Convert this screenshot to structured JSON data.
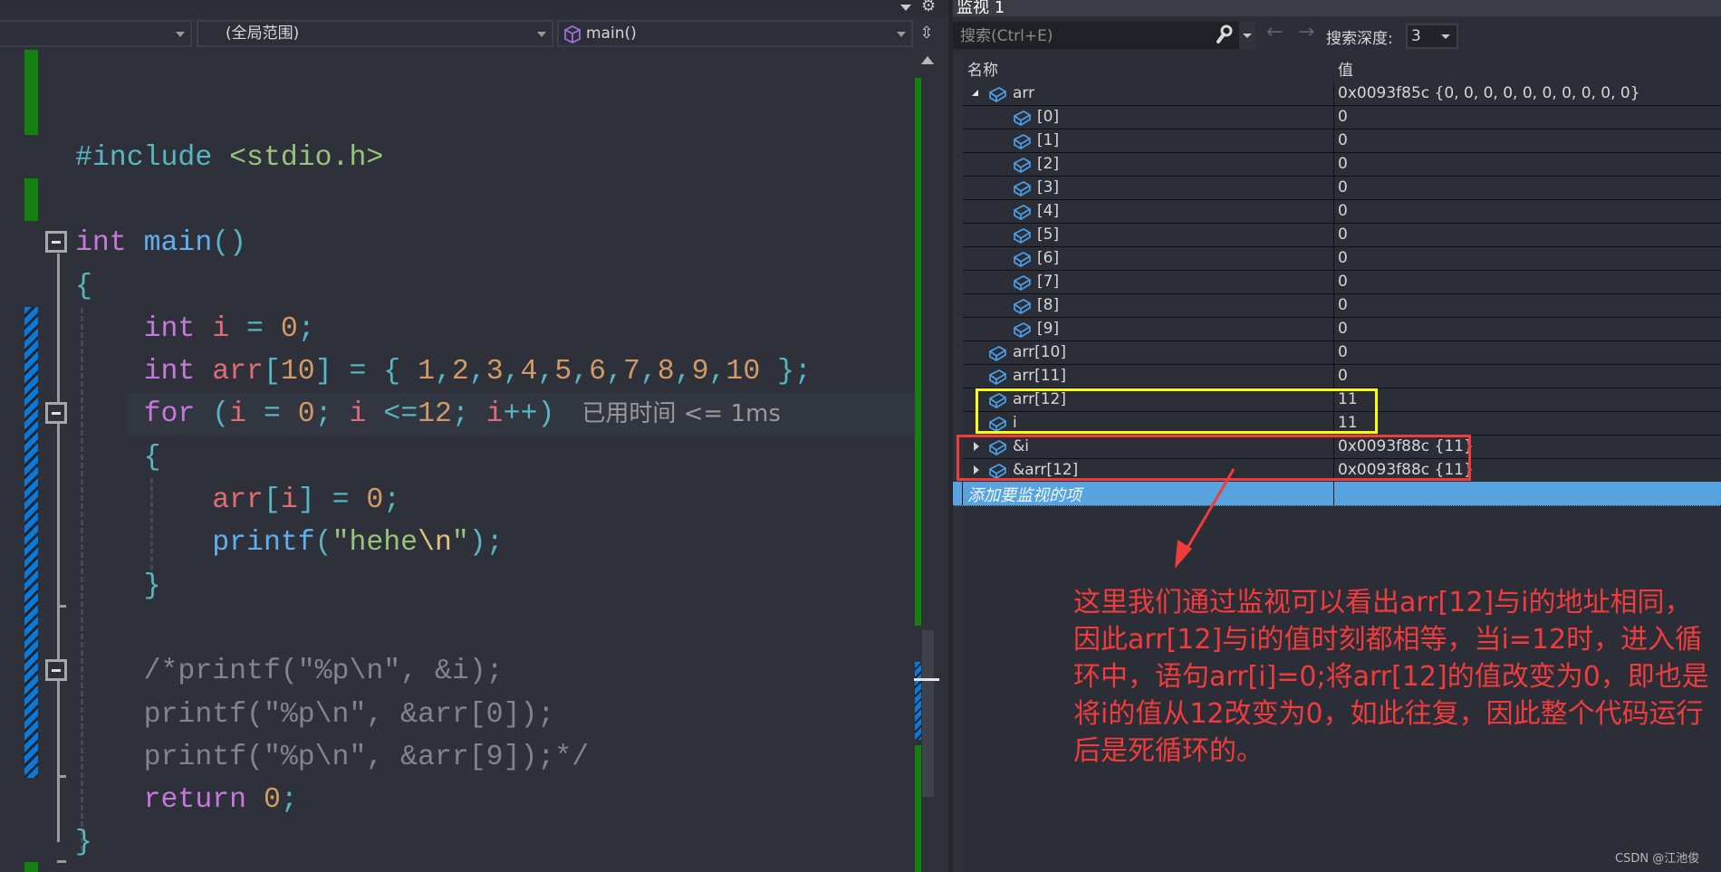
{
  "editor": {
    "nav": {
      "project_dropdown": "",
      "scope_dropdown": "(全局范围)",
      "function_dropdown": "main()"
    },
    "elapsed_hint": "已用时间 <= 1ms",
    "lines": [
      {
        "tokens": []
      },
      {
        "tokens": []
      },
      {
        "tokens": [
          {
            "t": "#include ",
            "c": "inc"
          },
          {
            "t": "<stdio.h>",
            "c": "hdr"
          }
        ]
      },
      {
        "tokens": []
      },
      {
        "tokens": [
          {
            "t": "int ",
            "c": "kw"
          },
          {
            "t": "main",
            "c": "fn"
          },
          {
            "t": "()",
            "c": "pun"
          }
        ]
      },
      {
        "tokens": [
          {
            "t": "{",
            "c": "pun"
          }
        ]
      },
      {
        "tokens": [
          {
            "t": "    "
          },
          {
            "t": "int ",
            "c": "kw"
          },
          {
            "t": "i",
            "c": "var"
          },
          {
            "t": " = ",
            "c": "pun"
          },
          {
            "t": "0",
            "c": "num"
          },
          {
            "t": ";",
            "c": "pun"
          }
        ]
      },
      {
        "tokens": [
          {
            "t": "    "
          },
          {
            "t": "int ",
            "c": "kw"
          },
          {
            "t": "arr",
            "c": "var"
          },
          {
            "t": "[",
            "c": "pun"
          },
          {
            "t": "10",
            "c": "num"
          },
          {
            "t": "] = { ",
            "c": "pun"
          },
          {
            "t": "1",
            "c": "num"
          },
          {
            "t": ",",
            "c": "pun"
          },
          {
            "t": "2",
            "c": "num"
          },
          {
            "t": ",",
            "c": "pun"
          },
          {
            "t": "3",
            "c": "num"
          },
          {
            "t": ",",
            "c": "pun"
          },
          {
            "t": "4",
            "c": "num"
          },
          {
            "t": ",",
            "c": "pun"
          },
          {
            "t": "5",
            "c": "num"
          },
          {
            "t": ",",
            "c": "pun"
          },
          {
            "t": "6",
            "c": "num"
          },
          {
            "t": ",",
            "c": "pun"
          },
          {
            "t": "7",
            "c": "num"
          },
          {
            "t": ",",
            "c": "pun"
          },
          {
            "t": "8",
            "c": "num"
          },
          {
            "t": ",",
            "c": "pun"
          },
          {
            "t": "9",
            "c": "num"
          },
          {
            "t": ",",
            "c": "pun"
          },
          {
            "t": "10",
            "c": "num"
          },
          {
            "t": " };",
            "c": "pun"
          }
        ]
      },
      {
        "tokens": [
          {
            "t": "    "
          },
          {
            "t": "for ",
            "c": "kw"
          },
          {
            "t": "(",
            "c": "pun"
          },
          {
            "t": "i",
            "c": "var"
          },
          {
            "t": " = ",
            "c": "pun"
          },
          {
            "t": "0",
            "c": "num"
          },
          {
            "t": "; ",
            "c": "pun"
          },
          {
            "t": "i",
            "c": "var"
          },
          {
            "t": " <=",
            "c": "pun"
          },
          {
            "t": "12",
            "c": "num"
          },
          {
            "t": "; ",
            "c": "pun"
          },
          {
            "t": "i",
            "c": "var"
          },
          {
            "t": "++)",
            "c": "pun"
          }
        ],
        "elapsed": true
      },
      {
        "tokens": [
          {
            "t": "    "
          },
          {
            "t": "{",
            "c": "pun"
          }
        ]
      },
      {
        "tokens": [
          {
            "t": "        "
          },
          {
            "t": "arr",
            "c": "var"
          },
          {
            "t": "[",
            "c": "pun"
          },
          {
            "t": "i",
            "c": "var"
          },
          {
            "t": "]",
            "c": "pun"
          },
          {
            "t": " = ",
            "c": "pun"
          },
          {
            "t": "0",
            "c": "num"
          },
          {
            "t": ";",
            "c": "pun"
          }
        ]
      },
      {
        "tokens": [
          {
            "t": "        "
          },
          {
            "t": "printf",
            "c": "fn"
          },
          {
            "t": "(",
            "c": "pun"
          },
          {
            "t": "\"hehe",
            "c": "str"
          },
          {
            "t": "\\n",
            "c": "esc"
          },
          {
            "t": "\"",
            "c": "str"
          },
          {
            "t": ");",
            "c": "pun"
          }
        ]
      },
      {
        "tokens": [
          {
            "t": "    "
          },
          {
            "t": "}",
            "c": "pun"
          }
        ]
      },
      {
        "tokens": []
      },
      {
        "tokens": [
          {
            "t": "    "
          },
          {
            "t": "/*printf(\"%p\\n\", &i);",
            "c": "cmt"
          }
        ]
      },
      {
        "tokens": [
          {
            "t": "    "
          },
          {
            "t": "printf(\"%p\\n\", &arr[0]);",
            "c": "cmt"
          }
        ]
      },
      {
        "tokens": [
          {
            "t": "    "
          },
          {
            "t": "printf(\"%p\\n\", &arr[9]);*/",
            "c": "cmt"
          }
        ]
      },
      {
        "tokens": [
          {
            "t": "    "
          },
          {
            "t": "return ",
            "c": "kw"
          },
          {
            "t": "0",
            "c": "num"
          },
          {
            "t": ";",
            "c": "pun"
          }
        ]
      },
      {
        "tokens": [
          {
            "t": "}",
            "c": "pun"
          }
        ]
      }
    ]
  },
  "watch": {
    "title": "监视 1",
    "search_placeholder": "搜索(Ctrl+E)",
    "back_label": "←",
    "forward_label": "→",
    "depth_label": "搜索深度:",
    "depth_value": "3",
    "columns": {
      "name": "名称",
      "value": "值"
    },
    "rows": [
      {
        "name": "arr",
        "value": "0x0093f85c {0, 0, 0, 0, 0, 0, 0, 0, 0, 0}",
        "level": 0,
        "expander": "expanded"
      },
      {
        "name": "[0]",
        "value": "0",
        "level": 1,
        "expander": "none"
      },
      {
        "name": "[1]",
        "value": "0",
        "level": 1,
        "expander": "none"
      },
      {
        "name": "[2]",
        "value": "0",
        "level": 1,
        "expander": "none"
      },
      {
        "name": "[3]",
        "value": "0",
        "level": 1,
        "expander": "none"
      },
      {
        "name": "[4]",
        "value": "0",
        "level": 1,
        "expander": "none"
      },
      {
        "name": "[5]",
        "value": "0",
        "level": 1,
        "expander": "none"
      },
      {
        "name": "[6]",
        "value": "0",
        "level": 1,
        "expander": "none"
      },
      {
        "name": "[7]",
        "value": "0",
        "level": 1,
        "expander": "none"
      },
      {
        "name": "[8]",
        "value": "0",
        "level": 1,
        "expander": "none"
      },
      {
        "name": "[9]",
        "value": "0",
        "level": 1,
        "expander": "none"
      },
      {
        "name": "arr[10]",
        "value": "0",
        "level": 0,
        "expander": "none"
      },
      {
        "name": "arr[11]",
        "value": "0",
        "level": 0,
        "expander": "none"
      },
      {
        "name": "arr[12]",
        "value": "11",
        "level": 0,
        "expander": "none"
      },
      {
        "name": "i",
        "value": "11",
        "level": 0,
        "expander": "none"
      },
      {
        "name": "&i",
        "value": "0x0093f88c {11}",
        "level": 0,
        "expander": "collapsed"
      },
      {
        "name": "&arr[12]",
        "value": "0x0093f88c {11}",
        "level": 0,
        "expander": "collapsed"
      }
    ],
    "add_item_placeholder": "添加要监视的项"
  },
  "annotation": {
    "text": "这里我们通过监视可以看出arr[12]与i的地址相同，因此arr[12]与i的值时刻都相等，当i=12时，进入循环中，语句arr[i]=0;将arr[12]的值改变为0，即也是将i的值从12改变为0，如此往复，因此整个代码运行后是死循环的。",
    "color": "#f23c3c",
    "highlight_yellow": "#ffff00",
    "highlight_red": "#f23c3c"
  },
  "watermark": "CSDN @江池俊"
}
